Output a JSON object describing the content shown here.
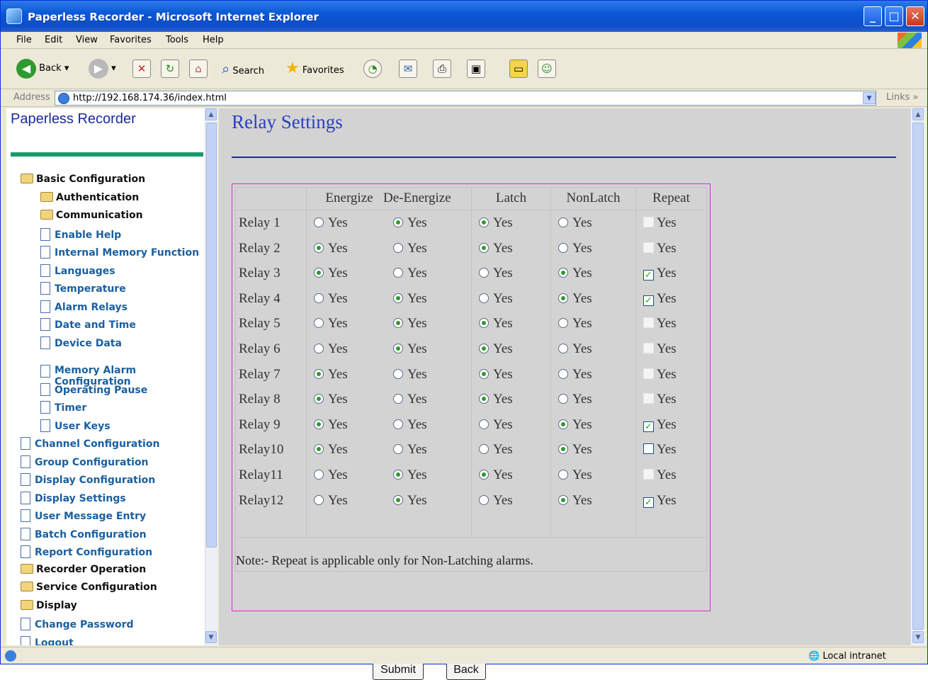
{
  "window": {
    "title": "Paperless Recorder - Microsoft Internet Explorer"
  },
  "menu": [
    "File",
    "Edit",
    "View",
    "Favorites",
    "Tools",
    "Help"
  ],
  "toolbar": {
    "back": "Back",
    "search": "Search",
    "favorites": "Favorites"
  },
  "address": {
    "label": "Address",
    "url": "http://192.168.174.36/index.html",
    "links": "Links"
  },
  "sidebar": {
    "title": "Paperless Recorder",
    "items": [
      {
        "label": "Basic Configuration",
        "type": "folder",
        "level": 0
      },
      {
        "label": "Authentication",
        "type": "folder",
        "level": 1
      },
      {
        "label": "Communication",
        "type": "folder",
        "level": 1
      },
      {
        "label": "Enable Help",
        "type": "doc",
        "level": 1
      },
      {
        "label": "Internal Memory Function",
        "type": "doc",
        "level": 1
      },
      {
        "label": "Languages",
        "type": "doc",
        "level": 1
      },
      {
        "label": "Temperature",
        "type": "doc",
        "level": 1
      },
      {
        "label": "Alarm Relays",
        "type": "doc",
        "level": 1
      },
      {
        "label": "Date and Time",
        "type": "doc",
        "level": 1
      },
      {
        "label": "Device Data",
        "type": "doc",
        "level": 1
      },
      {
        "label": "Memory Alarm Configuration",
        "type": "doc",
        "level": 1
      },
      {
        "label": "Operating Pause",
        "type": "doc",
        "level": 1
      },
      {
        "label": "Timer",
        "type": "doc",
        "level": 1
      },
      {
        "label": "User Keys",
        "type": "doc",
        "level": 1
      },
      {
        "label": "Channel Configuration",
        "type": "doc",
        "level": 0
      },
      {
        "label": "Group Configuration",
        "type": "doc",
        "level": 0
      },
      {
        "label": "Display Configuration",
        "type": "doc",
        "level": 0
      },
      {
        "label": "Display Settings",
        "type": "doc",
        "level": 0
      },
      {
        "label": "User Message Entry",
        "type": "doc",
        "level": 0
      },
      {
        "label": "Batch Configuration",
        "type": "doc",
        "level": 0
      },
      {
        "label": "Report Configuration",
        "type": "doc",
        "level": 0
      },
      {
        "label": "Recorder Operation",
        "type": "folder",
        "level": 0
      },
      {
        "label": "Service Configuration",
        "type": "folder",
        "level": 0
      },
      {
        "label": "Display",
        "type": "folder",
        "level": 0
      },
      {
        "label": "Change Password",
        "type": "doc",
        "level": 0
      },
      {
        "label": "Logout",
        "type": "doc",
        "level": 0
      }
    ]
  },
  "main": {
    "heading": "Relay Settings",
    "columns": [
      "Energize",
      "De-Energize",
      "Latch",
      "NonLatch",
      "Repeat"
    ],
    "option_label": "Yes",
    "relays": [
      {
        "name": "Relay 1",
        "energize": false,
        "latch": true,
        "repeat": "disabled"
      },
      {
        "name": "Relay 2",
        "energize": true,
        "latch": true,
        "repeat": "disabled"
      },
      {
        "name": "Relay 3",
        "energize": true,
        "latch": false,
        "repeat": "checked"
      },
      {
        "name": "Relay 4",
        "energize": false,
        "latch": false,
        "repeat": "checked"
      },
      {
        "name": "Relay 5",
        "energize": false,
        "latch": true,
        "repeat": "disabled"
      },
      {
        "name": "Relay 6",
        "energize": false,
        "latch": true,
        "repeat": "disabled"
      },
      {
        "name": "Relay 7",
        "energize": true,
        "latch": true,
        "repeat": "disabled"
      },
      {
        "name": "Relay 8",
        "energize": true,
        "latch": true,
        "repeat": "disabled"
      },
      {
        "name": "Relay 9",
        "energize": true,
        "latch": false,
        "repeat": "checked"
      },
      {
        "name": "Relay10",
        "energize": true,
        "latch": false,
        "repeat": "unchecked"
      },
      {
        "name": "Relay11",
        "energize": false,
        "latch": true,
        "repeat": "disabled"
      },
      {
        "name": "Relay12",
        "energize": false,
        "latch": false,
        "repeat": "checked"
      }
    ],
    "note": "Note:- Repeat is applicable only for Non-Latching alarms.",
    "submit_label": "Submit",
    "back_label": "Back"
  },
  "status": {
    "zone": "Local intranet"
  }
}
